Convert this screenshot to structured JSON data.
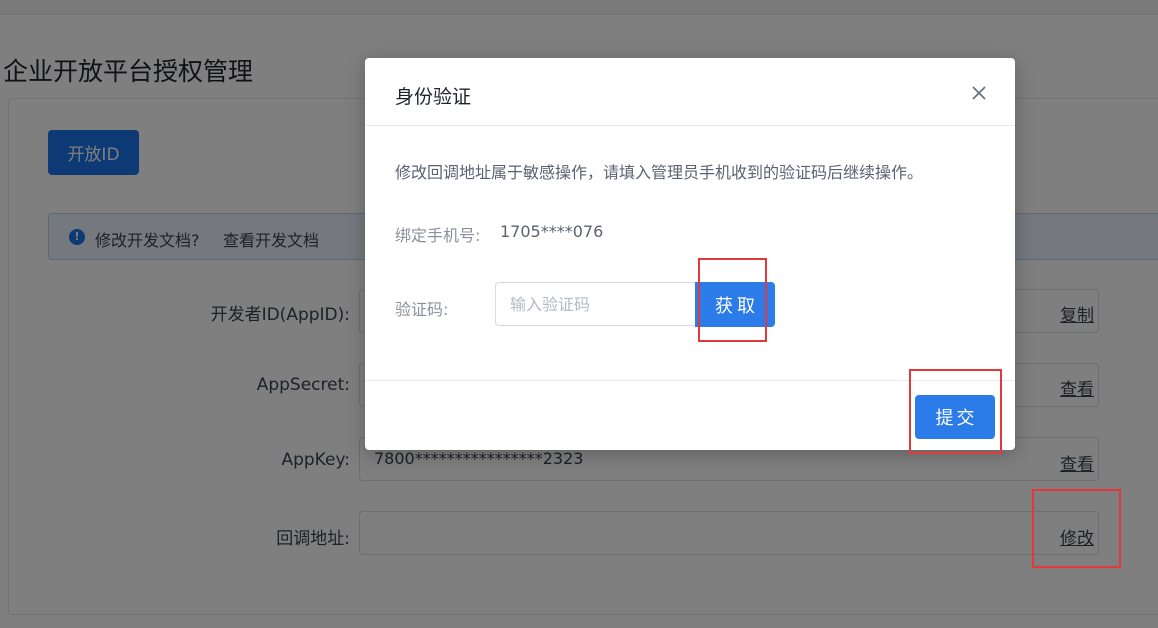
{
  "page": {
    "title": "企业开放平台授权管理",
    "open_id_button": "开放ID",
    "info": {
      "text": "修改开发文档?",
      "link": "查看开发文档"
    },
    "fields": [
      {
        "label": "开发者ID(AppID):",
        "value": "",
        "action": "复制"
      },
      {
        "label": "AppSecret:",
        "value": "",
        "action": "查看"
      },
      {
        "label": "AppKey:",
        "value": "7800****************2323",
        "action": "查看"
      },
      {
        "label": "回调地址:",
        "value": "",
        "action": "修改"
      }
    ]
  },
  "modal": {
    "title": "身份验证",
    "description": "修改回调地址属于敏感操作，请填入管理员手机收到的验证码后继续操作。",
    "phone_label": "绑定手机号:",
    "phone_value": "1705****076",
    "code_label": "验证码:",
    "code_placeholder": "输入验证码",
    "get_code_button": "获取",
    "submit_button": "提交"
  },
  "colors": {
    "primary": "#2b7ce9",
    "highlight": "#e5383b",
    "overlay": "rgba(0,0,0,0.5)"
  }
}
